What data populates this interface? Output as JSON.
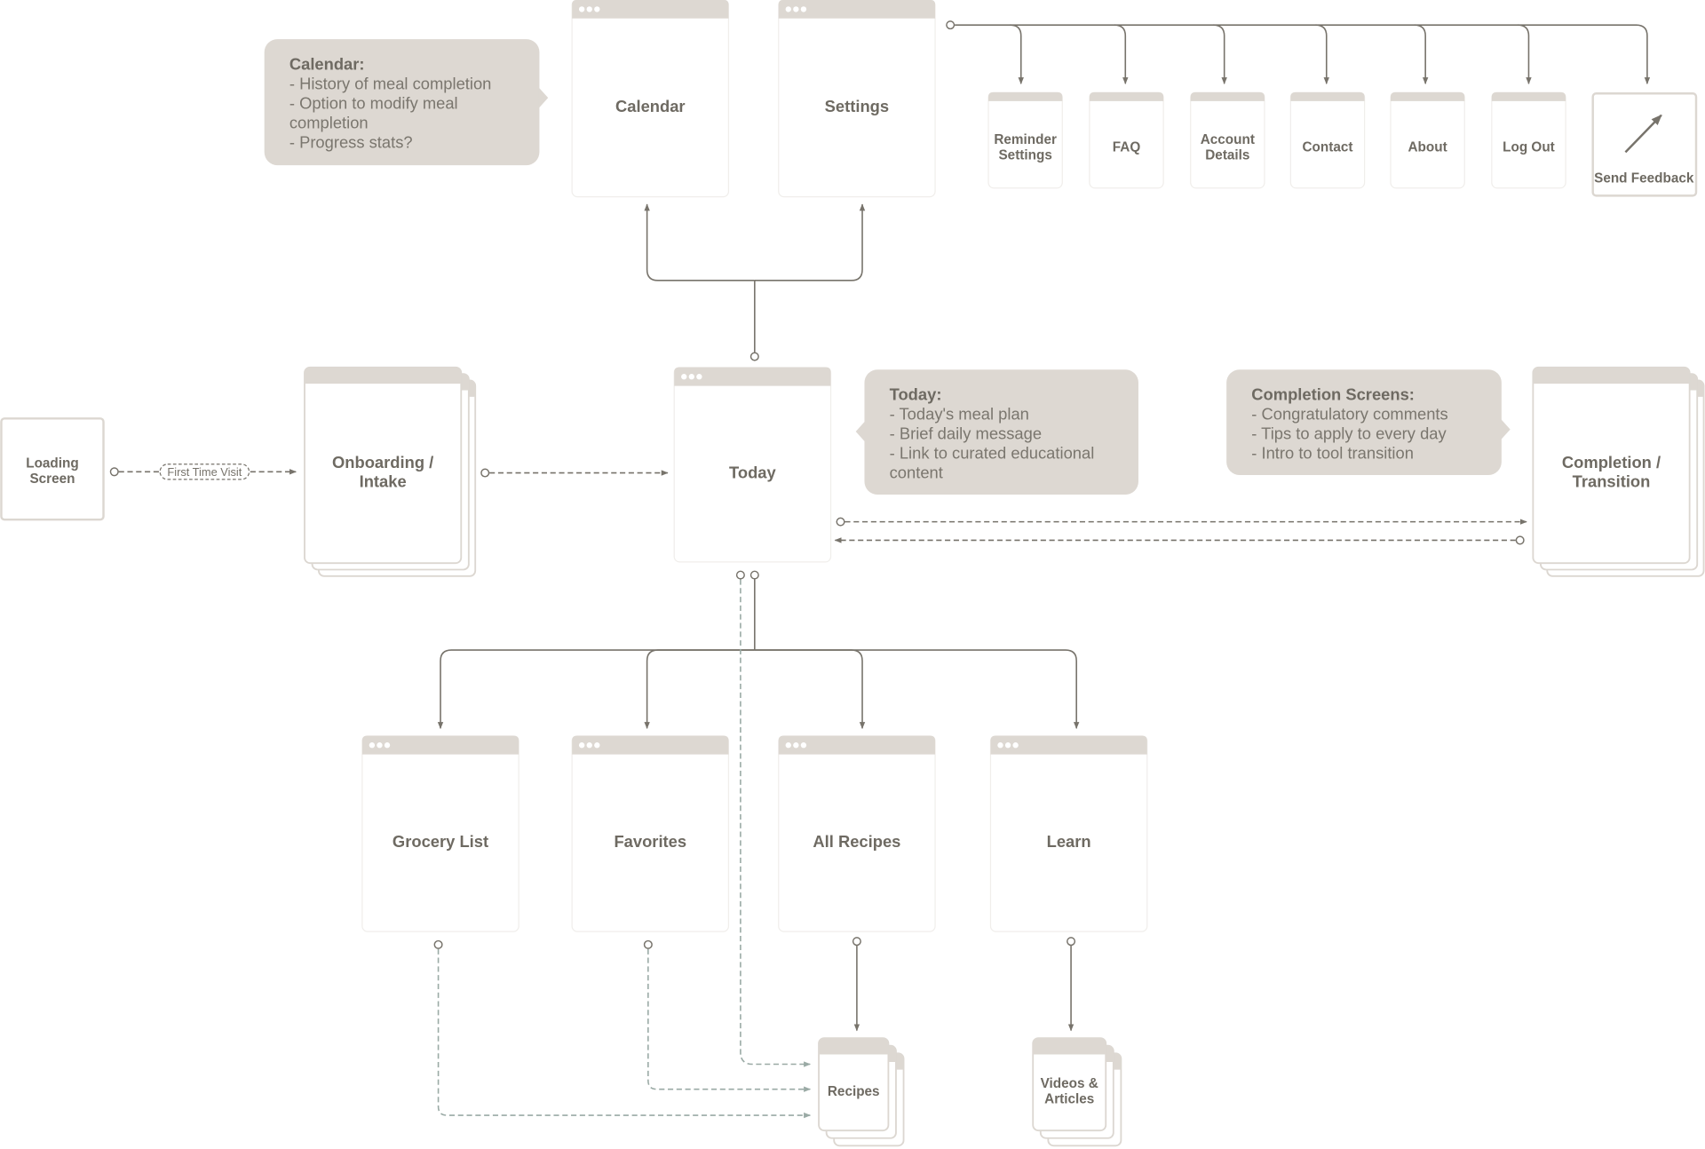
{
  "colors": {
    "header": "#ddd8d2",
    "text": "#6e6a62",
    "line": "#77736b",
    "dashed_teal": "#9aaaa5",
    "border": "#dcd7d1"
  },
  "screens": {
    "calendar": "Calendar",
    "settings": "Settings",
    "loading": [
      "Loading",
      "Screen"
    ],
    "onboarding": [
      "Onboarding /",
      "Intake"
    ],
    "today": "Today",
    "completion": [
      "Completion /",
      "Transition"
    ],
    "grocery": "Grocery List",
    "favorites": "Favorites",
    "all_recipes": "All Recipes",
    "learn": "Learn",
    "recipes": "Recipes",
    "videos": [
      "Videos &",
      "Articles"
    ]
  },
  "settings_children": [
    [
      "Reminder",
      "Settings"
    ],
    [
      "FAQ"
    ],
    [
      "Account",
      "Details"
    ],
    [
      "Contact"
    ],
    [
      "About"
    ],
    [
      "Log Out"
    ]
  ],
  "send_feedback": {
    "label": "Send Feedback",
    "icon": "arrow-up-right-icon"
  },
  "edge_label": "First Time Visit",
  "notes": {
    "calendar": {
      "title": "Calendar:",
      "lines": [
        "- History of meal completion",
        "- Option to modify meal",
        "completion",
        "- Progress stats?"
      ]
    },
    "today": {
      "title": "Today:",
      "lines": [
        "- Today's meal plan",
        "- Brief daily message",
        "- Link to curated educational",
        "content"
      ]
    },
    "completion": {
      "title": "Completion Screens:",
      "lines": [
        "- Congratulatory comments",
        "- Tips to apply to every day",
        "- Intro to tool transition"
      ]
    }
  }
}
